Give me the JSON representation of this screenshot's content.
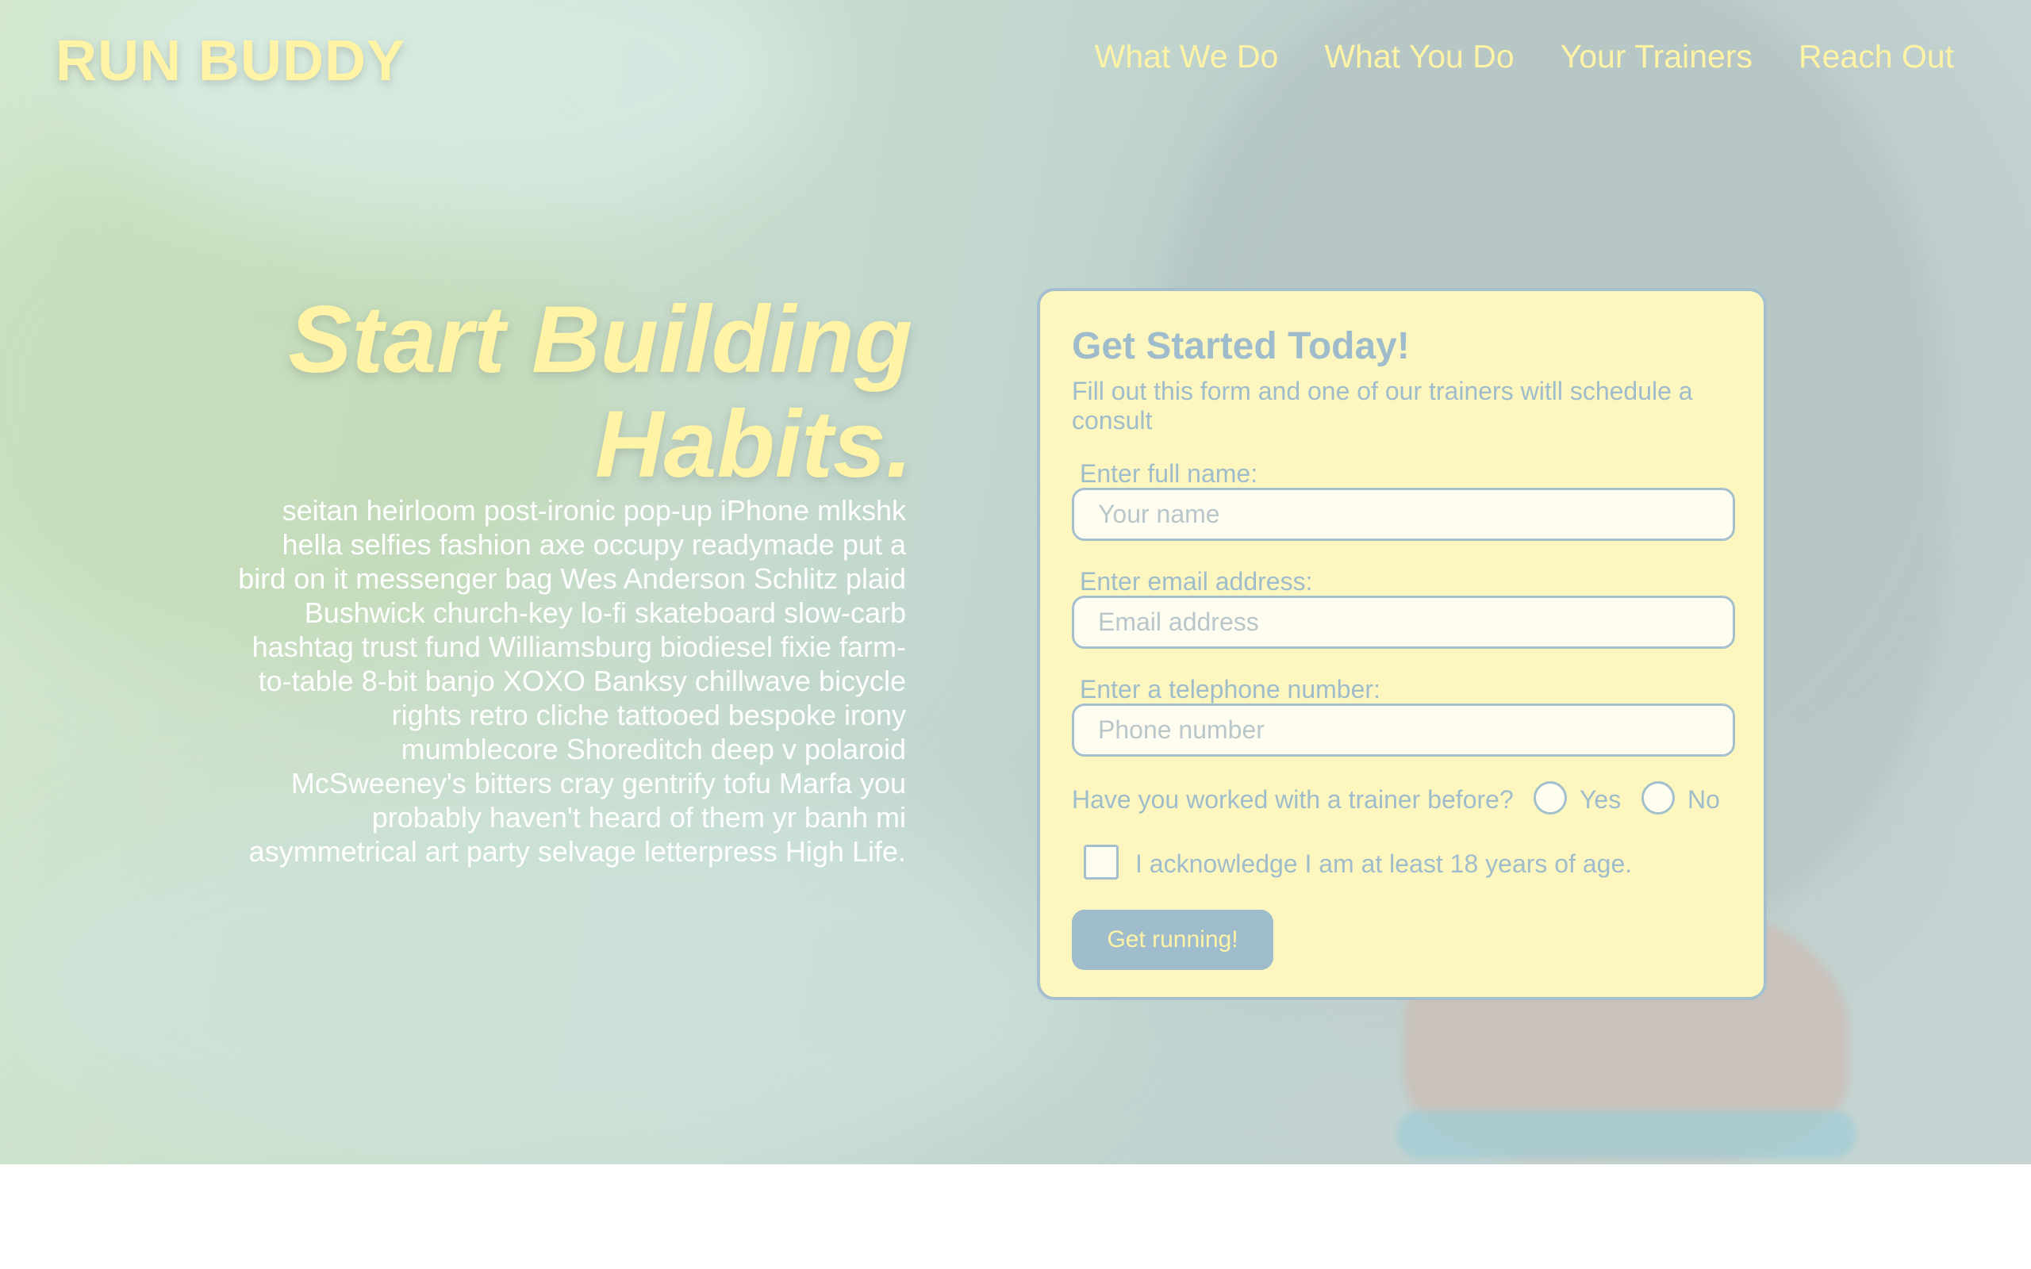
{
  "header": {
    "brand": "RUN BUDDY",
    "nav": [
      "What We Do",
      "What You Do",
      "Your Trainers",
      "Reach Out"
    ]
  },
  "hero": {
    "headline": "Start Building Habits.",
    "body": "seitan heirloom post-ironic pop-up iPhone mlkshk hella selfies fashion axe occupy readymade put a bird on it messenger bag Wes Anderson Schlitz plaid Bushwick church-key lo-fi skateboard slow-carb hashtag trust fund Williamsburg biodiesel fixie farm-to-table 8-bit banjo XOXO Banksy chillwave bicycle rights retro cliche tattooed bespoke irony mumblecore Shoreditch deep v polaroid McSweeney's bitters cray gentrify tofu Marfa you probably haven't heard of them yr banh mi asymmetrical art party selvage letterpress High Life."
  },
  "form": {
    "title": "Get Started Today!",
    "subtitle": "Fill out this form and one of our trainers witll schedule a consult",
    "name_label": "Enter full name:",
    "name_placeholder": "Your name",
    "email_label": "Enter email address:",
    "email_placeholder": "Email address",
    "phone_label": "Enter a telephone number:",
    "phone_placeholder": "Phone number",
    "trainer_question": "Have you worked with a trainer before?",
    "yes_label": "Yes",
    "no_label": "No",
    "age_label": "I acknowledge I am at least 18 years of age.",
    "submit_label": "Get running!"
  },
  "colors": {
    "accent_yellow": "#fff3a6",
    "form_bg": "#fdf7bf",
    "form_blue": "#9fbccc"
  }
}
